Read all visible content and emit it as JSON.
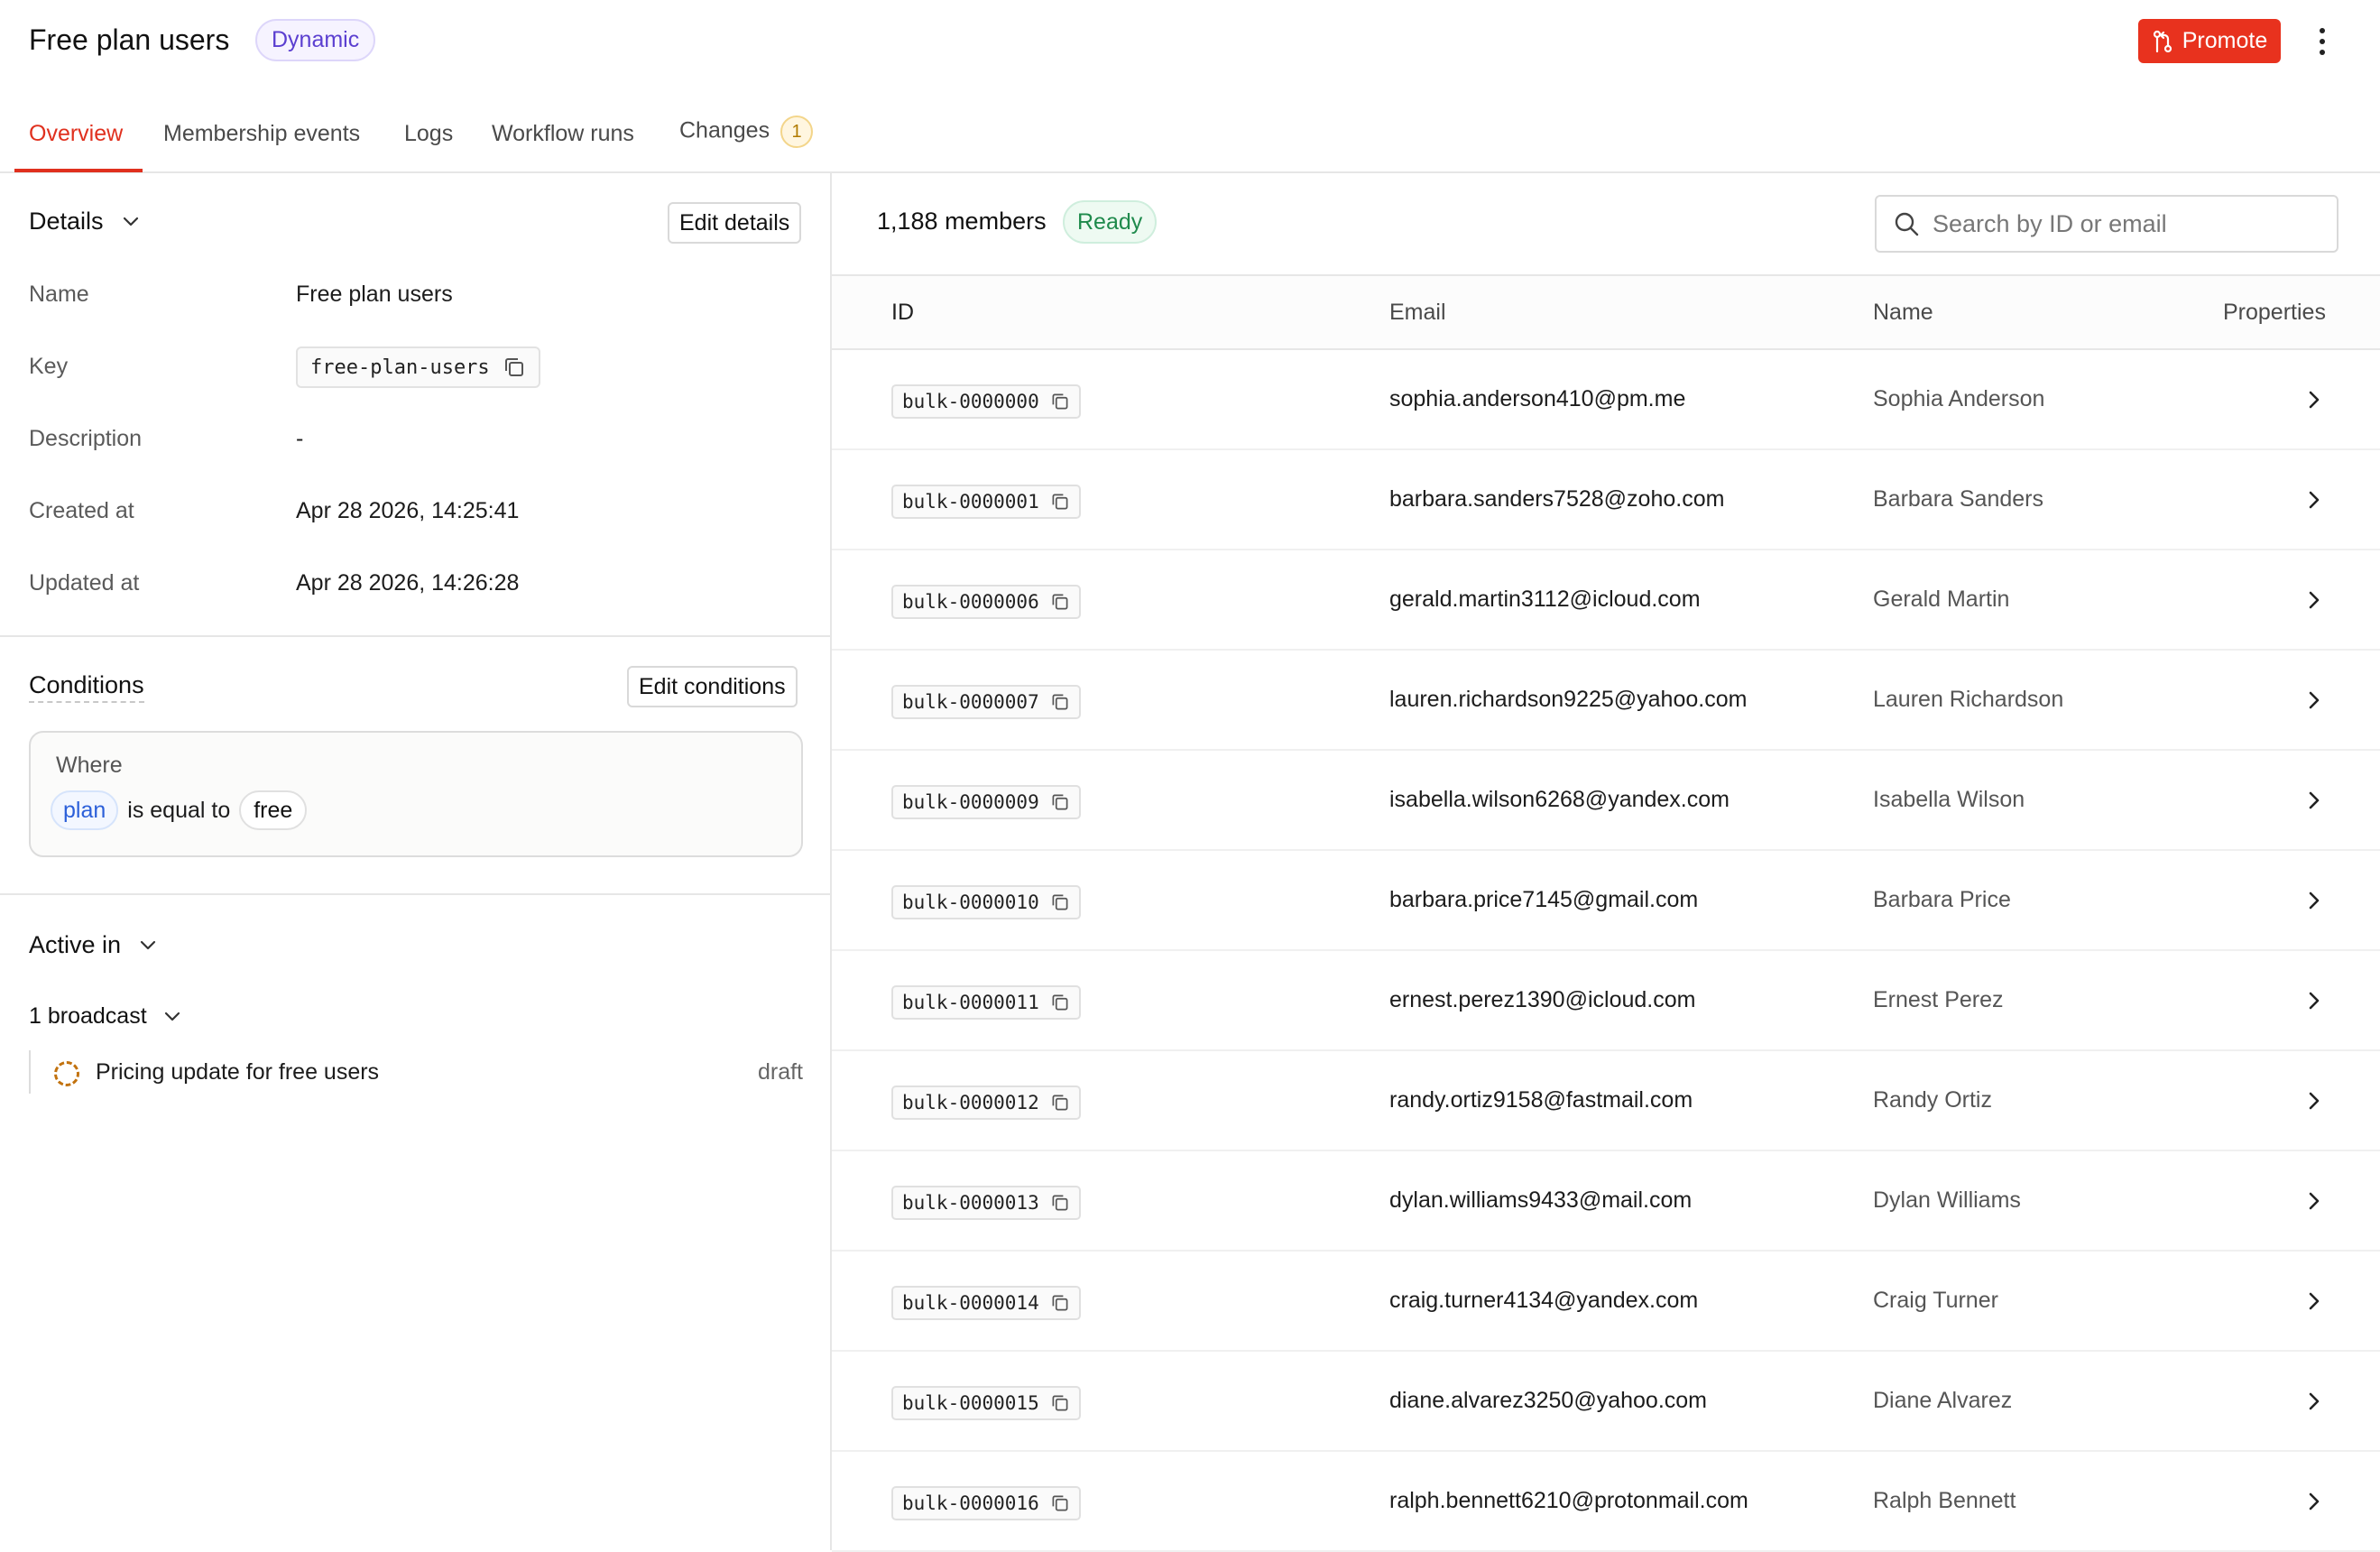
{
  "header": {
    "title": "Free plan users",
    "type_badge": "Dynamic",
    "promote_label": "Promote"
  },
  "tabs": [
    {
      "label": "Overview",
      "active": true
    },
    {
      "label": "Membership events"
    },
    {
      "label": "Logs"
    },
    {
      "label": "Workflow runs"
    },
    {
      "label": "Changes",
      "count": "1"
    }
  ],
  "details": {
    "heading": "Details",
    "edit_label": "Edit details",
    "fields": [
      {
        "label": "Name",
        "value": "Free plan users"
      },
      {
        "label": "Key",
        "value": "free-plan-users"
      },
      {
        "label": "Description",
        "value": "-"
      },
      {
        "label": "Created at",
        "value": "Apr 28 2026, 14:25:41"
      },
      {
        "label": "Updated at",
        "value": "Apr 28 2026, 14:26:28"
      }
    ]
  },
  "conditions": {
    "heading": "Conditions",
    "edit_label": "Edit conditions",
    "where_label": "Where",
    "property": "plan",
    "operator": "is equal to",
    "value": "free"
  },
  "active_in": {
    "heading": "Active in",
    "broadcast_count_label": "1 broadcast",
    "items": [
      {
        "name": "Pricing update for free users",
        "status": "draft"
      }
    ]
  },
  "members": {
    "count_label": "1,188 members",
    "status": "Ready",
    "search_placeholder": "Search by ID or email",
    "columns": {
      "id": "ID",
      "email": "Email",
      "name": "Name",
      "properties": "Properties"
    },
    "rows": [
      {
        "id": "bulk-0000000",
        "email": "sophia.anderson410@pm.me",
        "name": "Sophia Anderson"
      },
      {
        "id": "bulk-0000001",
        "email": "barbara.sanders7528@zoho.com",
        "name": "Barbara Sanders"
      },
      {
        "id": "bulk-0000006",
        "email": "gerald.martin3112@icloud.com",
        "name": "Gerald Martin"
      },
      {
        "id": "bulk-0000007",
        "email": "lauren.richardson9225@yahoo.com",
        "name": "Lauren Richardson"
      },
      {
        "id": "bulk-0000009",
        "email": "isabella.wilson6268@yandex.com",
        "name": "Isabella Wilson"
      },
      {
        "id": "bulk-0000010",
        "email": "barbara.price7145@gmail.com",
        "name": "Barbara Price"
      },
      {
        "id": "bulk-0000011",
        "email": "ernest.perez1390@icloud.com",
        "name": "Ernest Perez"
      },
      {
        "id": "bulk-0000012",
        "email": "randy.ortiz9158@fastmail.com",
        "name": "Randy Ortiz"
      },
      {
        "id": "bulk-0000013",
        "email": "dylan.williams9433@mail.com",
        "name": "Dylan Williams"
      },
      {
        "id": "bulk-0000014",
        "email": "craig.turner4134@yandex.com",
        "name": "Craig Turner"
      },
      {
        "id": "bulk-0000015",
        "email": "diane.alvarez3250@yahoo.com",
        "name": "Diane Alvarez"
      },
      {
        "id": "bulk-0000016",
        "email": "ralph.bennett6210@protonmail.com",
        "name": "Ralph Bennett"
      }
    ]
  },
  "colors": {
    "accent": "#e0301e",
    "promote_bg": "#e8321e",
    "dynamic_badge": "#5b3fd0",
    "ready_badge": "#1f8a4c",
    "draft_status": "#c2720e"
  },
  "icons": [
    "promote-icon",
    "kebab-menu-icon",
    "chevron-down-icon",
    "copy-icon",
    "search-icon",
    "chevron-right-icon",
    "draft-status-icon"
  ]
}
